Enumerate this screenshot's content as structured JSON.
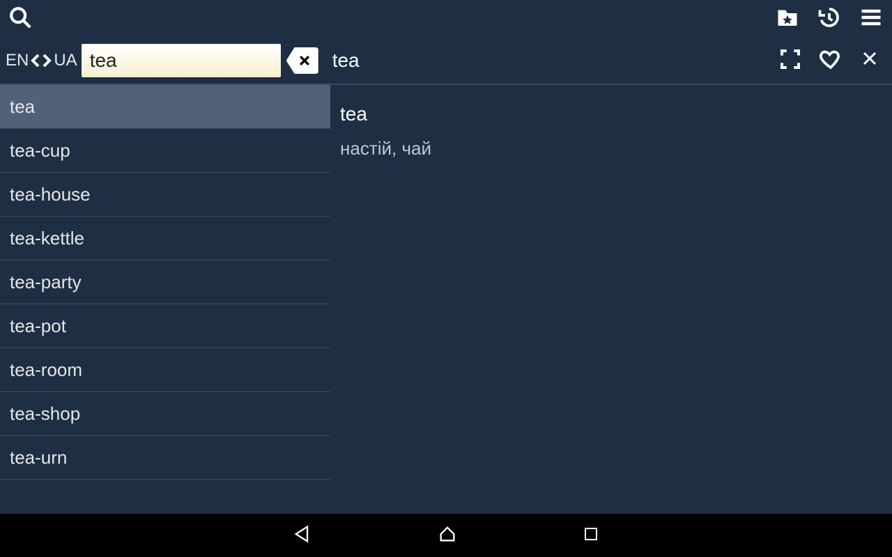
{
  "langFrom": "EN",
  "langTo": "UA",
  "searchValue": "tea",
  "headerWord": "tea",
  "entryHead": "tea",
  "entryBody": "настій, чай",
  "suggestions": [
    "tea",
    "tea-cup",
    "tea-house",
    "tea-kettle",
    "tea-party",
    "tea-pot",
    "tea-room",
    "tea-shop",
    "tea-urn"
  ],
  "selectedIndex": 0
}
